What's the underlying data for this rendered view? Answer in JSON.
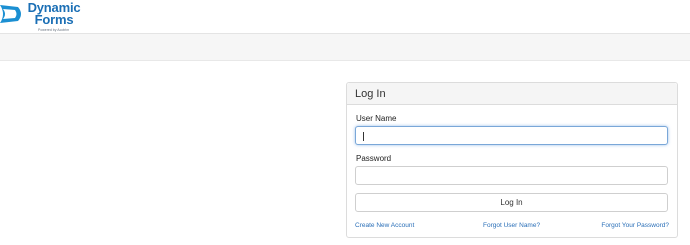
{
  "brand": {
    "name_line1": "Dynamic",
    "name_line2": "Forms",
    "tagline": "Powered by Acotrim"
  },
  "login": {
    "title": "Log In",
    "username_label": "User Name",
    "username_value": "",
    "password_label": "Password",
    "password_value": "",
    "submit_label": "Log In",
    "links": {
      "create_account": "Create New Account",
      "forgot_username": "Forgot User Name?",
      "forgot_password": "Forgot Your Password?"
    }
  },
  "colors": {
    "brand_blue": "#1b6fb5",
    "link_blue": "#2a6fb8",
    "focus_border": "#7aa7d8"
  }
}
